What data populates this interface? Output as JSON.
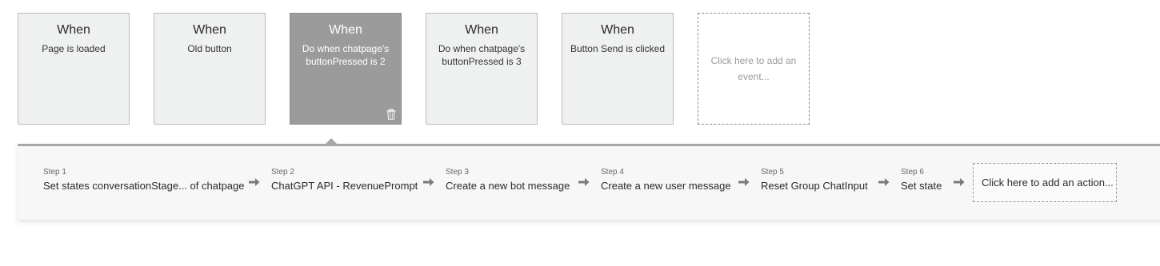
{
  "events": [
    {
      "title": "When",
      "description": "Page is loaded"
    },
    {
      "title": "When",
      "description": "Old button"
    },
    {
      "title": "When",
      "description": "Do when chatpage's buttonPressed is 2",
      "selected": true
    },
    {
      "title": "When",
      "description": "Do when chatpage's buttonPressed is 3"
    },
    {
      "title": "When",
      "description": "Button Send is clicked"
    }
  ],
  "add_event_label": "Click here to add an event...",
  "steps": [
    {
      "number": "Step 1",
      "name": "Set states conversationStage... of chatpage"
    },
    {
      "number": "Step 2",
      "name": "ChatGPT API - RevenuePrompt"
    },
    {
      "number": "Step 3",
      "name": "Create a new bot message"
    },
    {
      "number": "Step 4",
      "name": "Create a new user message"
    },
    {
      "number": "Step 5",
      "name": "Reset Group ChatInput"
    },
    {
      "number": "Step 6",
      "name": "Set state"
    }
  ],
  "add_action_label": "Click here to add an action...",
  "colors": {
    "card_bg": "#eff1f0",
    "selected_bg": "#9b9b9b",
    "panel_bg": "#f7f7f7",
    "arrow": "#7a7a7a"
  },
  "icons": {
    "delete": "trash-icon",
    "step_separator": "arrow-right-icon"
  }
}
